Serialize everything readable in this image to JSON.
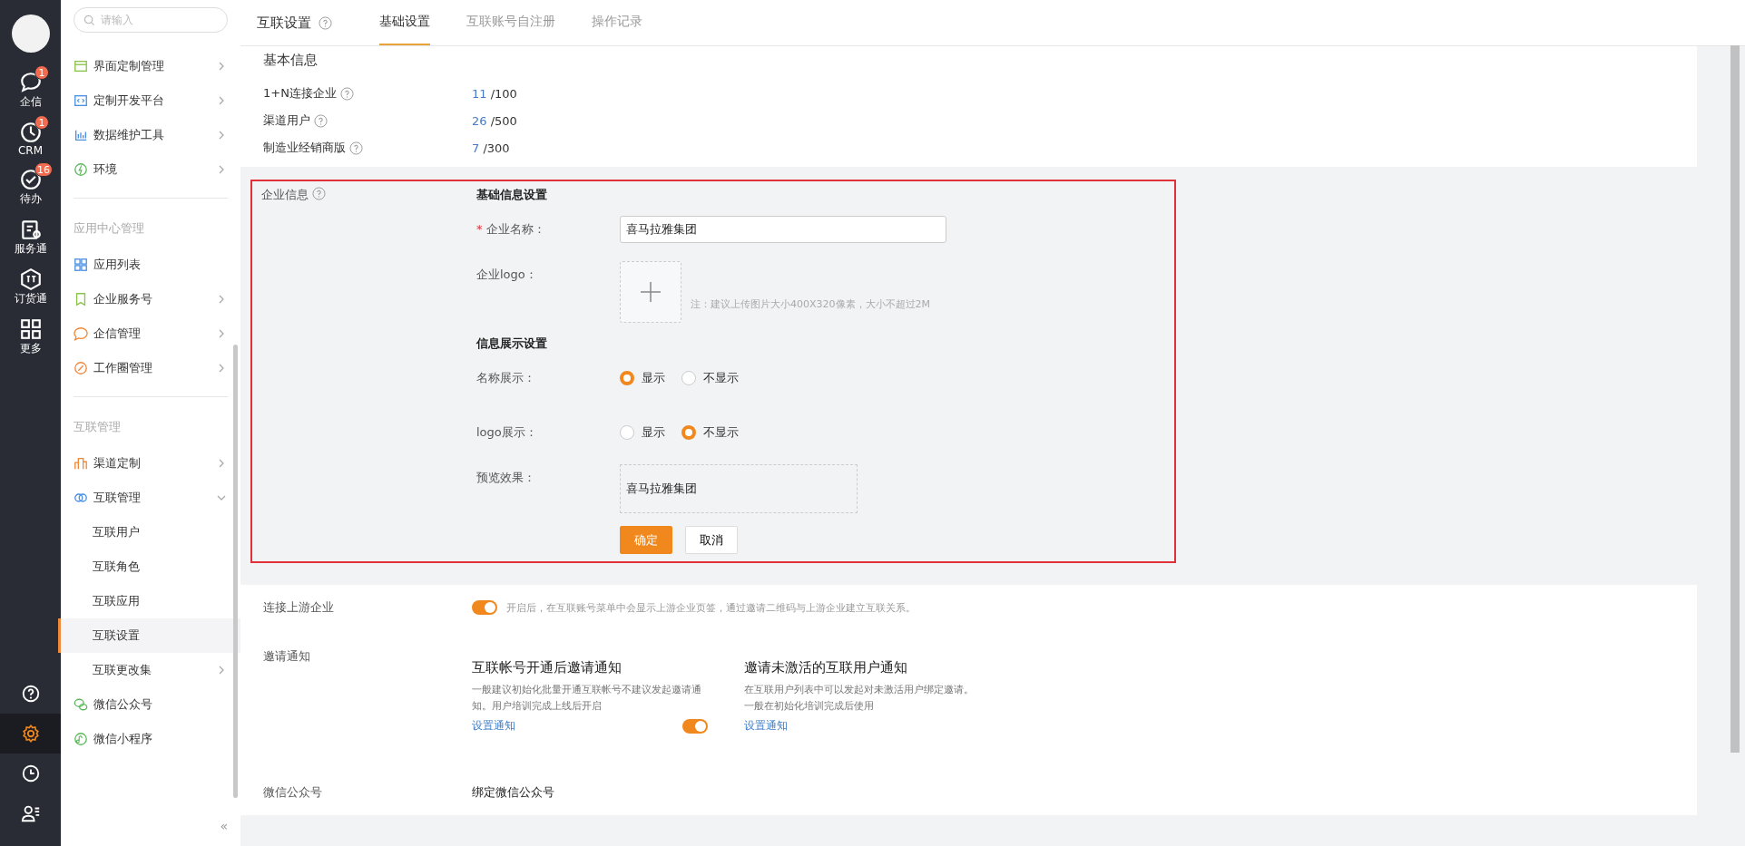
{
  "rail": {
    "items": [
      {
        "label": "企信",
        "badge": "1"
      },
      {
        "label": "CRM",
        "badge": "1"
      },
      {
        "label": "待办",
        "badge": "16"
      },
      {
        "label": "服务通"
      },
      {
        "label": "订货通"
      },
      {
        "label": "更多"
      }
    ],
    "bottom_items": [
      {
        "selected": false
      },
      {
        "selected": true
      },
      {
        "selected": false
      },
      {
        "selected": false
      }
    ]
  },
  "sidebar": {
    "search": {
      "placeholder": "请输入"
    },
    "collapse": "«",
    "groups": [
      {
        "items": [
          {
            "label": "界面定制管理",
            "kind": "submenu",
            "expanded": false,
            "selected": false
          },
          {
            "label": "定制开发平台",
            "kind": "submenu",
            "expanded": false,
            "selected": false
          },
          {
            "label": "数据维护工具",
            "kind": "submenu",
            "expanded": false,
            "selected": false
          },
          {
            "label": "环境",
            "kind": "submenu",
            "expanded": false,
            "selected": false
          }
        ]
      },
      {
        "title": "应用中心管理",
        "items": [
          {
            "label": "应用列表",
            "kind": "link",
            "selected": false
          },
          {
            "label": "企业服务号",
            "kind": "submenu",
            "expanded": false,
            "selected": false
          },
          {
            "label": "企信管理",
            "kind": "submenu",
            "expanded": false,
            "selected": false
          },
          {
            "label": "工作圈管理",
            "kind": "submenu",
            "expanded": false,
            "selected": false
          }
        ]
      },
      {
        "title": "互联管理",
        "items": [
          {
            "label": "渠道定制",
            "kind": "submenu",
            "expanded": false,
            "selected": false
          },
          {
            "label": "互联管理",
            "kind": "submenu",
            "expanded": true,
            "selected": false,
            "children": [
              {
                "label": "互联用户",
                "kind": "link",
                "selected": false
              },
              {
                "label": "互联角色",
                "kind": "link",
                "selected": false
              },
              {
                "label": "互联应用",
                "kind": "link",
                "selected": false
              },
              {
                "label": "互联设置",
                "kind": "link",
                "selected": true
              },
              {
                "label": "互联更改集",
                "kind": "submenu",
                "expanded": false,
                "selected": false
              }
            ]
          },
          {
            "label": "微信公众号",
            "kind": "link",
            "selected": false
          },
          {
            "label": "微信小程序",
            "kind": "link",
            "selected": false
          }
        ]
      }
    ]
  },
  "header": {
    "title": "互联设置",
    "tabs": [
      {
        "label": "基础设置",
        "selected": true
      },
      {
        "label": "互联账号自注册",
        "selected": false
      },
      {
        "label": "操作记录",
        "selected": false
      }
    ]
  },
  "basic_info": {
    "heading": "基本信息",
    "rows": [
      {
        "label": "1+N连接企业",
        "used": "11",
        "limit": "/100"
      },
      {
        "label": "渠道用户",
        "used": "26",
        "limit": "/500"
      },
      {
        "label": "制造业经销商版",
        "used": "7",
        "limit": "/300"
      }
    ]
  },
  "company_info": {
    "label": "企业信息",
    "basic_heading": "基础信息设置",
    "name_field": {
      "label": "企业名称：",
      "required": true,
      "required_mark": "*",
      "value": "喜马拉雅集团"
    },
    "logo": {
      "label": "企业logo：",
      "note": "注：建议上传图片大小400X320像素，大小不超过2M"
    },
    "display_heading": "信息展示设置",
    "display_options": [
      {
        "label": "名称展示：",
        "options": [
          {
            "label": "显示",
            "selected": true
          },
          {
            "label": "不显示",
            "selected": false
          }
        ]
      },
      {
        "label": "logo展示：",
        "options": [
          {
            "label": "显示",
            "selected": false
          },
          {
            "label": "不显示",
            "selected": true
          }
        ]
      }
    ],
    "preview": {
      "label": "预览效果：",
      "text": "喜马拉雅集团"
    },
    "buttons": [
      {
        "label": "确定",
        "kind": "primary"
      },
      {
        "label": "取消",
        "kind": "default"
      }
    ]
  },
  "upstream": {
    "label": "连接上游企业",
    "on": true,
    "description": "开启后，在互联账号菜单中会显示上游企业页签，通过邀请二维码与上游企业建立互联关系。"
  },
  "invite": {
    "label": "邀请通知",
    "cards": [
      {
        "title": "互联帐号开通后邀请通知",
        "description": "一般建议初始化批量开通互联帐号不建议发起邀请通知。用户培训完成上线后开启",
        "link": "设置通知",
        "kind": "toggle",
        "on": true
      },
      {
        "title": "邀请未激活的互联用户通知",
        "description": "在互联用户列表中可以发起对未激活用户绑定邀请。一般在初始化培训完成后使用",
        "link": "设置通知",
        "kind": "plain"
      }
    ]
  },
  "wechat": {
    "label": "微信公众号",
    "heading": "绑定微信公众号"
  }
}
